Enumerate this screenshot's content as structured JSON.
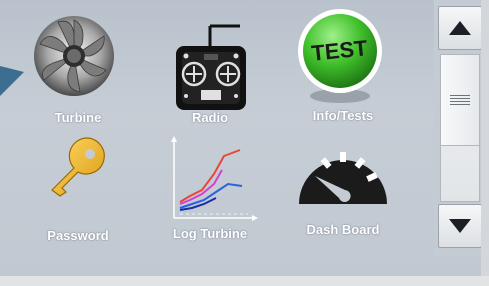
{
  "menu": {
    "items": [
      {
        "label": "Turbine",
        "icon": "turbine-icon"
      },
      {
        "label": "Radio",
        "icon": "radio-transmitter-icon"
      },
      {
        "label": "Info/Tests",
        "icon": "test-badge-icon",
        "badge_text": "TEST"
      },
      {
        "label": "Password",
        "icon": "key-icon"
      },
      {
        "label": "Log Turbine",
        "icon": "log-chart-icon"
      },
      {
        "label": "Dash Board",
        "icon": "gauge-icon"
      }
    ]
  },
  "scrollbar": {
    "up_icon": "triangle-up-icon",
    "down_icon": "triangle-down-icon",
    "grip_icon": "grip-lines-icon"
  },
  "colors": {
    "screen_background": "#c0c8d1",
    "label_text": "#ffffff",
    "test_badge_green": "#3fbf2a",
    "key_gold": "#f0b92a",
    "log_line_red": "#e8453c",
    "log_line_magenta": "#d63fd1",
    "log_line_blue": "#2a62e0",
    "log_line_darkblue": "#1a2fa0"
  }
}
